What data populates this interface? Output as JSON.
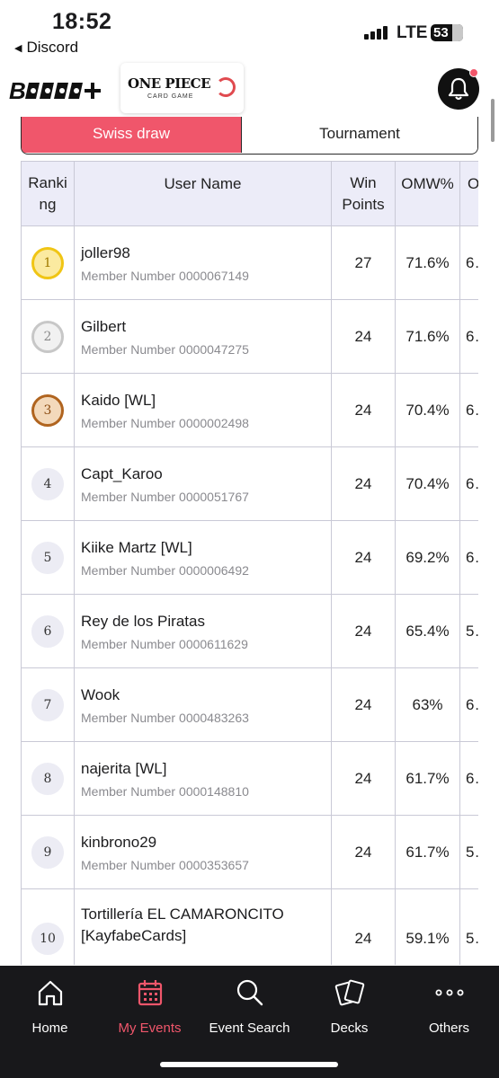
{
  "status_bar": {
    "time": "18:52",
    "back_label": "Discord",
    "network": "LTE",
    "battery": "53"
  },
  "header": {
    "brand_logo_text": "B",
    "game_logo_title": "ONE PIECE",
    "game_logo_subtitle": "CARD GAME",
    "notification_icon": "bell-icon",
    "notification_dot_color": "#f2566a"
  },
  "tabs": [
    {
      "label": "Swiss draw",
      "active": true
    },
    {
      "label": "Tournament",
      "active": false
    }
  ],
  "accent_color": "#f0566b",
  "table": {
    "headers": {
      "ranking": "Ranki\nng",
      "user_name": "User Name",
      "win_points": "Win Points",
      "omw": "OMW%",
      "next": "O"
    },
    "member_label": "Member Number",
    "rows": [
      {
        "rank": "1",
        "name": "joller98",
        "member": "0000067149",
        "win": "27",
        "omw": "71.6%",
        "next": "6…"
      },
      {
        "rank": "2",
        "name": "Gilbert",
        "member": "0000047275",
        "win": "24",
        "omw": "71.6%",
        "next": "6…"
      },
      {
        "rank": "3",
        "name": "Kaido [WL]",
        "member": "0000002498",
        "win": "24",
        "omw": "70.4%",
        "next": "6…"
      },
      {
        "rank": "4",
        "name": "Capt_Karoo",
        "member": "0000051767",
        "win": "24",
        "omw": "70.4%",
        "next": "6…"
      },
      {
        "rank": "5",
        "name": "Kiike Martz [WL]",
        "member": "0000006492",
        "win": "24",
        "omw": "69.2%",
        "next": "6…"
      },
      {
        "rank": "6",
        "name": "Rey de los Piratas",
        "member": "0000611629",
        "win": "24",
        "omw": "65.4%",
        "next": "5…"
      },
      {
        "rank": "7",
        "name": "Wook",
        "member": "0000483263",
        "win": "24",
        "omw": "63%",
        "next": "6…"
      },
      {
        "rank": "8",
        "name": "najerita [WL]",
        "member": "0000148810",
        "win": "24",
        "omw": "61.7%",
        "next": "6…"
      },
      {
        "rank": "9",
        "name": "kinbrono29",
        "member": "0000353657",
        "win": "24",
        "omw": "61.7%",
        "next": "5…"
      },
      {
        "rank": "10",
        "name": "Tortillería EL CAMARONCITO [KayfabeCards]",
        "member": "",
        "win": "24",
        "omw": "59.1%",
        "next": "5…"
      }
    ]
  },
  "bottom_nav": [
    {
      "label": "Home",
      "icon": "home-icon",
      "active": false
    },
    {
      "label": "My Events",
      "icon": "calendar-icon",
      "active": true
    },
    {
      "label": "Event Search",
      "icon": "search-icon",
      "active": false
    },
    {
      "label": "Decks",
      "icon": "cards-icon",
      "active": false
    },
    {
      "label": "Others",
      "icon": "more-icon",
      "active": false
    }
  ]
}
